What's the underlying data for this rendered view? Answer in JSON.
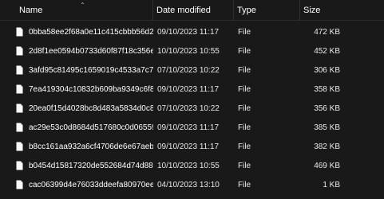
{
  "header": {
    "name": "Name",
    "date_modified": "Date modified",
    "type": "Type",
    "size": "Size",
    "sort_icon": "chevron-up-icon"
  },
  "colors": {
    "background": "#191919",
    "text": "#ffffff",
    "divider": "#2f2f2f"
  },
  "files": [
    {
      "name": "0bba58ee2f68a0e11c415cbbb56d2",
      "date": "09/10/2023 11:17",
      "type": "File",
      "size": "472 KB",
      "icon": "file-icon"
    },
    {
      "name": "2d8f1ee0594b0733d60f87f18c356e",
      "date": "10/10/2023 10:55",
      "type": "File",
      "size": "452 KB",
      "icon": "file-icon"
    },
    {
      "name": "3afd95c81495c1659019c4533a7c71",
      "date": "07/10/2023 10:22",
      "type": "File",
      "size": "306 KB",
      "icon": "file-icon"
    },
    {
      "name": "7ea419304c10832b609ba9349c6f8b",
      "date": "09/10/2023 11:17",
      "type": "File",
      "size": "358 KB",
      "icon": "file-icon"
    },
    {
      "name": "20ea0f15d4028bc8d483a5834d0c8c",
      "date": "07/10/2023 10:22",
      "type": "File",
      "size": "356 KB",
      "icon": "file-icon"
    },
    {
      "name": "ac29e53c0d8684d517680c0d065598",
      "date": "09/10/2023 11:17",
      "type": "File",
      "size": "385 KB",
      "icon": "file-icon"
    },
    {
      "name": "b8cc161aa932a6cf4706de6e67aebb",
      "date": "09/10/2023 11:17",
      "type": "File",
      "size": "382 KB",
      "icon": "file-icon"
    },
    {
      "name": "b0454d15817320de552684d74d882",
      "date": "10/10/2023 10:55",
      "type": "File",
      "size": "469 KB",
      "icon": "file-icon"
    },
    {
      "name": "cac06399d4e76033ddeefa80970eeb",
      "date": "04/10/2023 13:10",
      "type": "File",
      "size": "1 KB",
      "icon": "file-icon"
    }
  ]
}
